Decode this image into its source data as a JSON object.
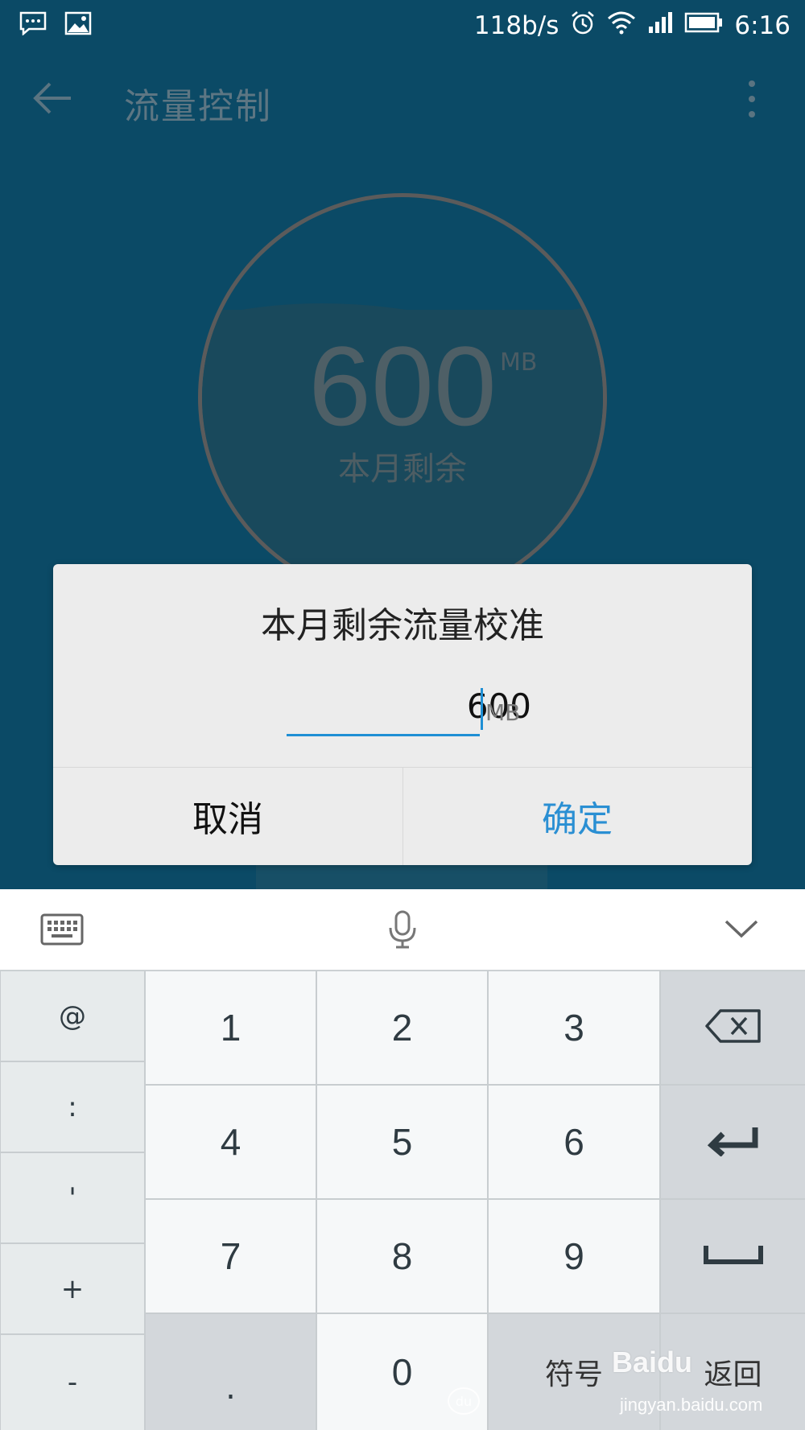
{
  "status_bar": {
    "net_speed": "118b/s",
    "time": "6:16",
    "left_icons": [
      "message-icon",
      "image-icon"
    ],
    "right_icons": [
      "alarm-icon",
      "wifi-icon",
      "signal-icon",
      "battery-icon"
    ]
  },
  "app_bar": {
    "title": "流量控制",
    "back_icon": "back-arrow-icon",
    "menu_icon": "more-vert-icon"
  },
  "gauge": {
    "value": "600",
    "unit": "MB",
    "caption": "本月剩余"
  },
  "dialog": {
    "title": "本月剩余流量校准",
    "input_value": "600",
    "input_unit": "MB",
    "cancel_label": "取消",
    "ok_label": "确定"
  },
  "keyboard": {
    "toolbar_icons": [
      "keyboard-icon",
      "mic-icon",
      "chevron-down-icon"
    ],
    "symbol_keys": [
      "@",
      ":",
      "'",
      "+",
      "-"
    ],
    "number_rows": [
      [
        "1",
        "2",
        "3"
      ],
      [
        "4",
        "5",
        "6"
      ],
      [
        "7",
        "8",
        "9"
      ]
    ],
    "dot_key": ".",
    "zero_key": "0",
    "symbols_label": "符号",
    "return_label": "返回"
  },
  "watermark": {
    "brand": "Baidu",
    "url": "jingyan.baidu.com",
    "du": "du"
  },
  "colors": {
    "app_bg": "#0b4a66",
    "accent": "#2a8fd3",
    "dialog_bg": "#ececec",
    "key_bg": "#f6f8f9",
    "func_key_bg": "#d3d7db"
  }
}
